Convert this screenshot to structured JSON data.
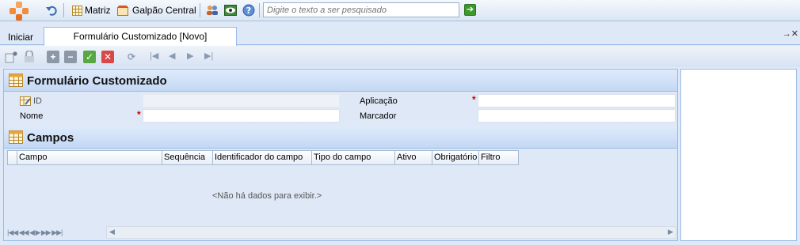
{
  "topbar": {
    "back_icon": "undo-icon",
    "branch_label": "Matriz",
    "warehouse_label": "Galpão Central",
    "search_placeholder": "Digite o texto a ser pesquisado"
  },
  "tabbar": {
    "start_label": "Iniciar",
    "active_tab": "Formulário Customizado [Novo]",
    "pin_glyph": "→✕"
  },
  "form": {
    "title": "Formulário Customizado",
    "fields": {
      "id_label": "ID",
      "name_label": "Nome",
      "application_label": "Aplicação",
      "marker_label": "Marcador",
      "required_mark": "*"
    }
  },
  "fields_section": {
    "title": "Campos",
    "columns": [
      "Campo",
      "Sequência",
      "Identificador do campo",
      "Tipo do campo",
      "Ativo",
      "Obrigatório",
      "Filtro"
    ],
    "empty_message": "<Não há dados para exibir.>"
  },
  "colors": {
    "accent": "#99bbe8",
    "logo": "#f28c3a",
    "required": "#cc0000"
  }
}
